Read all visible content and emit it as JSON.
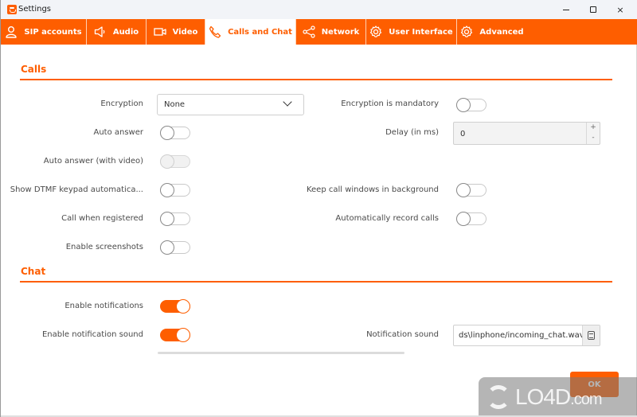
{
  "window": {
    "title": "Settings",
    "controls": {
      "minimize": "minimize",
      "maximize": "maximize",
      "close": "×"
    }
  },
  "tabs": [
    {
      "label": "SIP accounts",
      "icon": "user-icon",
      "active": false
    },
    {
      "label": "Audio",
      "icon": "speaker-icon",
      "active": false
    },
    {
      "label": "Video",
      "icon": "video-camera-icon",
      "active": false
    },
    {
      "label": "Calls and Chat",
      "icon": "phone-icon",
      "active": true
    },
    {
      "label": "Network",
      "icon": "share-icon",
      "active": false
    },
    {
      "label": "User Interface",
      "icon": "gear-icon",
      "active": false
    },
    {
      "label": "Advanced",
      "icon": "gear-icon",
      "active": false
    }
  ],
  "calls": {
    "title": "Calls",
    "encryption": {
      "label": "Encryption",
      "value": "None"
    },
    "encryption_mandatory": {
      "label": "Encryption is mandatory",
      "on": false
    },
    "auto_answer": {
      "label": "Auto answer",
      "on": false
    },
    "delay": {
      "label": "Delay (in ms)",
      "value": "0",
      "plus": "+",
      "minus": "-"
    },
    "auto_answer_video": {
      "label": "Auto answer (with video)",
      "on": false,
      "disabled": true
    },
    "show_dtmf": {
      "label": "Show DTMF keypad automatica...",
      "on": false
    },
    "keep_call_windows": {
      "label": "Keep call windows in background",
      "on": false
    },
    "call_when_registered": {
      "label": "Call when registered",
      "on": false
    },
    "auto_record": {
      "label": "Automatically record calls",
      "on": false
    },
    "enable_screenshots": {
      "label": "Enable screenshots",
      "on": false
    }
  },
  "chat": {
    "title": "Chat",
    "enable_notifications": {
      "label": "Enable notifications",
      "on": true
    },
    "enable_notification_sound": {
      "label": "Enable notification sound",
      "on": true
    },
    "notification_sound": {
      "label": "Notification sound",
      "value": "ds\\linphone/incoming_chat.wav"
    }
  },
  "footer": {
    "ok_label": "OK"
  },
  "watermark": {
    "text": "LO4D",
    "suffix": ".com"
  },
  "colors": {
    "accent": "#fe5e00",
    "tab_text": "#ffffff",
    "label_text": "#4a4a4a"
  }
}
